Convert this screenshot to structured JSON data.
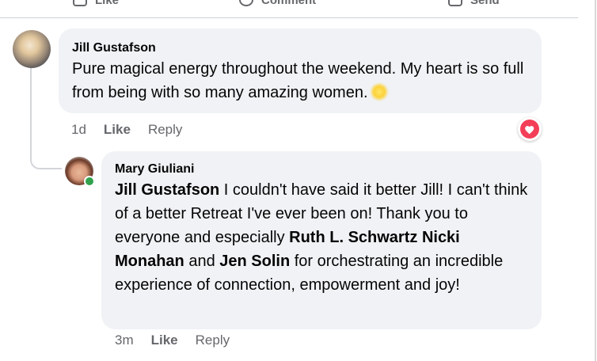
{
  "top_actions": {
    "like_label": "Like",
    "comment_label": "Comment",
    "send_label": "Send"
  },
  "comment": {
    "author": "Jill Gustafson",
    "text": "Pure magical energy throughout the weekend. My heart is so full from being with so many amazing women.",
    "emoji": "sun-emoji",
    "time": "1d",
    "like_label": "Like",
    "reply_label": "Reply",
    "reaction": "heart"
  },
  "reply": {
    "author": "Mary Giuliani",
    "mention_1": "Jill Gustafson",
    "text_1": " I couldn't have said it better Jill! I can't think of a better Retreat I've ever been on! Thank you to everyone and especially ",
    "mention_2": "Ruth L. Schwartz",
    "text_2": " ",
    "mention_3": "Nicki Monahan",
    "text_3": " and ",
    "mention_4": "Jen Solin",
    "text_4": " for orchestrating an incredible experience of connection, empowerment and joy!",
    "time": "3m",
    "like_label": "Like",
    "reply_label": "Reply",
    "online": true
  },
  "colors": {
    "bubble_bg": "#f0f2f5",
    "secondary_text": "#65676b",
    "love_red": "#f33e58",
    "online_green": "#31a24c"
  }
}
